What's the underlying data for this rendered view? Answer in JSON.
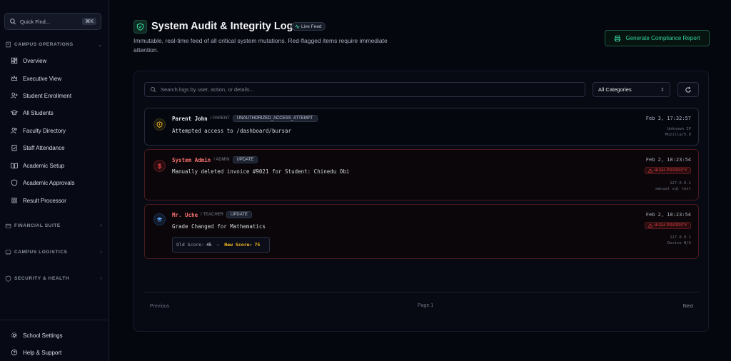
{
  "sidebar": {
    "quick_find": {
      "placeholder": "Quick Find...",
      "shortcut": "⌘K"
    },
    "campus_operations": {
      "label": "CAMPUS OPERATIONS",
      "items": [
        {
          "label": "Overview",
          "icon": "dashboard-icon"
        },
        {
          "label": "Executive View",
          "icon": "crown-icon"
        },
        {
          "label": "Student Enrollment",
          "icon": "user-plus-icon"
        },
        {
          "label": "All Students",
          "icon": "graduation-cap-icon"
        },
        {
          "label": "Faculty Directory",
          "icon": "users-icon"
        },
        {
          "label": "Staff Attendance",
          "icon": "clipboard-check-icon"
        },
        {
          "label": "Academic Setup",
          "icon": "book-open-icon"
        },
        {
          "label": "Academic Approvals",
          "icon": "shield-check-icon"
        },
        {
          "label": "Result Processor",
          "icon": "cpu-icon"
        }
      ]
    },
    "financial_suite": {
      "label": "FINANCIAL SUITE"
    },
    "campus_logistics": {
      "label": "CAMPUS LOGISTICS"
    },
    "security_health": {
      "label": "SECURITY & HEALTH"
    },
    "footer": {
      "settings": "School Settings",
      "help": "Help & Support"
    }
  },
  "header": {
    "title": "System Audit & Integrity Log",
    "live_badge": "Live Feed",
    "subtitle": "Immutable, real-time feed of all critical system mutations. Red-flagged items require immediate attention.",
    "compliance_button": "Generate Compliance Report"
  },
  "toolbar": {
    "search_placeholder": "Search logs by user, action, or details...",
    "category_selected": "All Categories"
  },
  "entries": [
    {
      "user": "Parent John",
      "role": "PARENT",
      "action": "UNAUTHORIZED_ACCESS_ATTEMPT",
      "description": "Attempted access to /dashboard/bursar",
      "time": "Feb 3, 17:32:57",
      "meta_ip": "Unknown IP",
      "meta_device": "Mozilla/5.0",
      "flagged": false
    },
    {
      "user": "System Admin",
      "role": "ADMIN",
      "action": "UPDATE",
      "description": "Manually deleted invoice #9021 for Student: Chinedu Obi",
      "time": "Feb 2, 18:23:54",
      "priority": "HIGH PRIORITY",
      "meta_ip": "127.0.0.1",
      "meta_device": "manual sql test",
      "flagged": true
    },
    {
      "user": "Mr. Uche",
      "role": "TEACHER",
      "action": "UPDATE",
      "description": "Grade Changed for Mathematics",
      "time": "Feb 2, 18:23:54",
      "priority": "HIGH PRIORITY",
      "meta_ip": "127.0.0.1",
      "meta_device": "Device N/A",
      "old_score_label": "Old Score:",
      "old_score": "45",
      "new_score_label": "New Score:",
      "new_score": "75",
      "flagged": true
    }
  ],
  "pagination": {
    "previous": "Previous",
    "page": "Page 1",
    "next": "Next"
  },
  "colors": {
    "accent_green": "#34d399",
    "danger_red": "#ef4444",
    "warning_amber": "#fbbf24",
    "background": "#05070f"
  }
}
